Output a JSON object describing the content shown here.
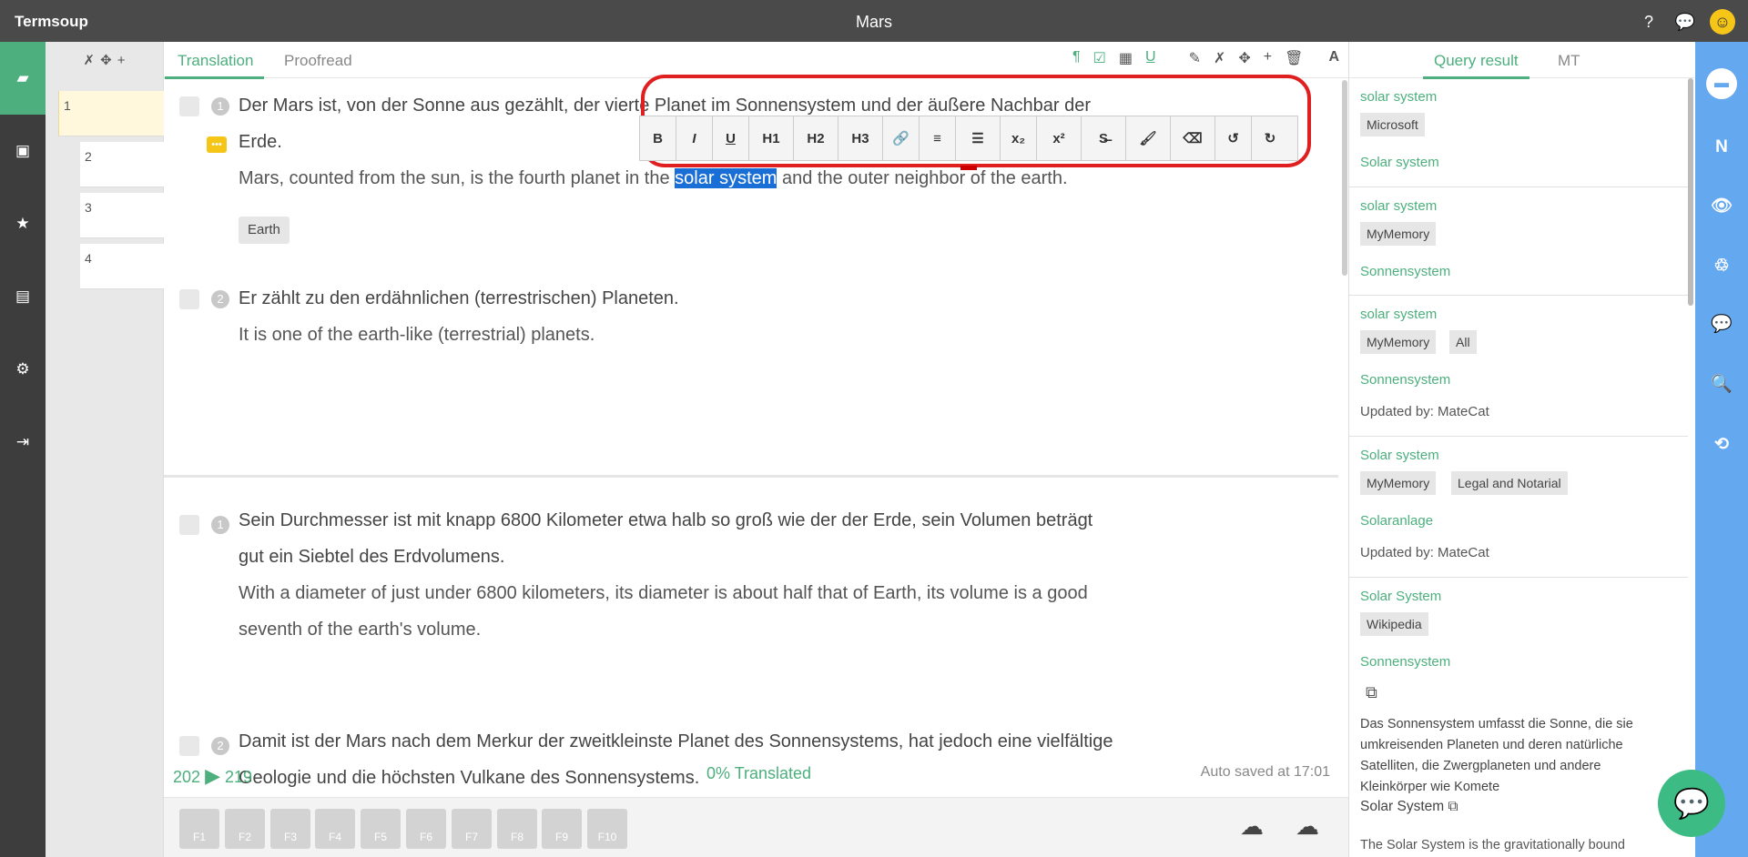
{
  "header": {
    "app_name": "Termsoup",
    "doc_title": "Mars",
    "help_icon": "?",
    "chat_icon": "💬",
    "smiley_icon": "☺"
  },
  "left_nav": {
    "items": [
      "folder-icon",
      "film-icon",
      "star-icon",
      "store-icon",
      "gear-icon",
      "logout-icon"
    ],
    "glyphs": [
      "▰",
      "▣",
      "★",
      "▤",
      "⚙",
      "⇥"
    ]
  },
  "segments": {
    "tools": [
      "✗",
      "✥",
      "+"
    ],
    "items": [
      "1",
      "2",
      "3",
      "4"
    ]
  },
  "tabs": {
    "translation": "Translation",
    "proofread": "Proofread"
  },
  "toolbar_icons": [
    "¶",
    "☑",
    "▦",
    "U̲",
    "✎",
    "✗",
    "✥",
    "+",
    "🗑",
    "A"
  ],
  "format_bar": [
    "B",
    "I",
    "U",
    "H1",
    "H2",
    "H3",
    "🔗",
    "≡",
    "☰",
    "x₂",
    "x²",
    "S̶",
    "🖌",
    "⌫",
    "↺",
    "↻"
  ],
  "paragraphs": [
    {
      "sentences": [
        {
          "num": "1",
          "source": "Der Mars ist, von der Sonne aus gezählt, der vierte Planet im Sonnensystem und der äußere Nachbar der",
          "source2": "Erde.",
          "target_pre": "Mars, counted from the sun, is the fourth planet in the ",
          "target_sel": "solar system",
          "target_post": " and the outer neighbor of the earth.",
          "tag": "Earth"
        },
        {
          "num": "2",
          "source": "Er zählt zu den erdähnlichen (terrestrischen) Planeten.",
          "target": "It is one of the earth-like (terrestrial) planets."
        }
      ]
    },
    {
      "sentences": [
        {
          "num": "1",
          "source": "Sein Durchmesser ist mit knapp 6800 Kilometer etwa halb so groß wie der der Erde, sein Volumen beträgt",
          "source2": "gut ein Siebtel des Erdvolumens.",
          "target": "With a diameter of just under 6800 kilometers, its diameter is about half that of Earth, its volume is a good",
          "target2": "seventh of the earth's volume."
        },
        {
          "num": "2",
          "source": "Damit ist der Mars nach dem Merkur der zweitkleinste Planet des Sonnensystems, hat jedoch eine vielfältige",
          "source2": "Geologie und die höchsten Vulkane des Sonnensystems."
        }
      ]
    }
  ],
  "status": {
    "count_left": "202",
    "arrow": "▶",
    "count_right": "219",
    "progress": "0% Translated",
    "saved": "Auto saved at 17:01"
  },
  "fkeys": [
    "F1",
    "F2",
    "F3",
    "F4",
    "F5",
    "F6",
    "F7",
    "F8",
    "F9",
    "F10"
  ],
  "cloud_icons": {
    "upload": "☁",
    "download": "☁"
  },
  "right_tabs": {
    "query": "Query result",
    "mt": "MT"
  },
  "query_results": [
    {
      "src": "solar system",
      "tags": [
        "Microsoft"
      ],
      "tgt": "Solar system"
    },
    {
      "src": "solar system",
      "tags": [
        "MyMemory"
      ],
      "tgt": "Sonnensystem"
    },
    {
      "src": "solar system",
      "tags": [
        "MyMemory",
        "All"
      ],
      "tgt": "Sonnensystem",
      "updated": "Updated by:  MateCat"
    },
    {
      "src": "Solar system",
      "tags": [
        "MyMemory",
        "Legal and Notarial"
      ],
      "tgt": "Solaranlage",
      "updated": "Updated by:  MateCat"
    },
    {
      "src": "Solar System",
      "tags": [
        "Wikipedia"
      ],
      "tgt": "Sonnensystem",
      "link": "⧉",
      "desc": "Das Sonnensystem umfasst die Sonne, die sie umkreisenden Planeten und deren natürliche Satelliten, die Zwergplaneten und andere Kleinkörper wie Komete",
      "solar_label": "Solar System",
      "cut_text": "The Solar System is the gravitationally bound"
    }
  ],
  "right_nav": [
    "N",
    "👁",
    "♲",
    "💬",
    "🔍",
    "⟲"
  ],
  "chat_button": "💬"
}
